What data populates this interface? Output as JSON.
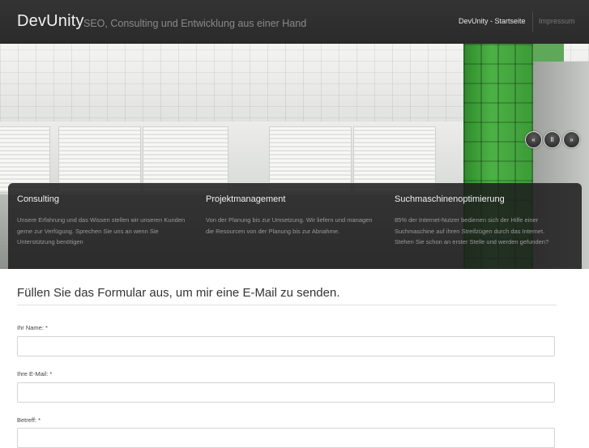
{
  "header": {
    "brand": "DevUnity",
    "tagline": "SEO, Consulting und Entwicklung aus einer Hand",
    "nav": [
      {
        "label": "DevUnity - Startseite"
      },
      {
        "label": "Impressum"
      }
    ]
  },
  "slider": {
    "controls": [
      {
        "icon": "rewind-icon",
        "glyph": "«"
      },
      {
        "icon": "pause-icon",
        "glyph": "II"
      },
      {
        "icon": "fast-forward-icon",
        "glyph": "»"
      }
    ]
  },
  "features": [
    {
      "title": "Consulting",
      "text": "Unsere Erfahrung und das Wissen stellen wir unseren Kunden gerne zur Verfügung. Sprechen Sie uns an wenn Sie Unterstützung benötigen"
    },
    {
      "title": "Projektmanagement",
      "text": "Von der Planung bis zur Umsetzung. Wir liefern und managen die Resourcen von der Planung bis zur Abnahme."
    },
    {
      "title": "Suchmaschinenoptimierung",
      "text": "85% der Internet-Nutzer bedienen sich der Hilfe einer Suchmaschine auf ihren Streifzügen durch das Internet. Stehen Sie schon an erster Stelle und werden gefunden?"
    }
  ],
  "form": {
    "title": "Füllen Sie das Formular aus, um mir eine E-Mail zu senden.",
    "fields": [
      {
        "label": "Ihr Name: *",
        "value": ""
      },
      {
        "label": "Ihre E-Mail: *",
        "value": ""
      },
      {
        "label": "Betreff: *",
        "value": ""
      }
    ]
  },
  "colors": {
    "header_bg": "#2f2f2f",
    "accent_green": "#4cb145"
  }
}
